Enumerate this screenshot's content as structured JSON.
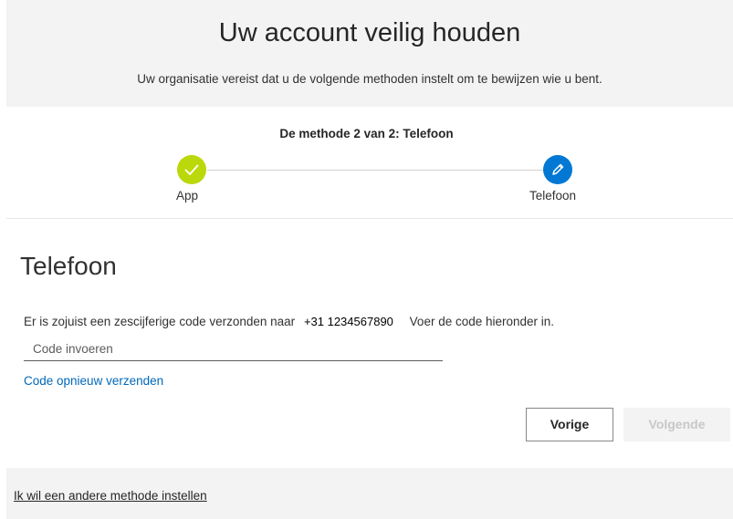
{
  "header": {
    "title": "Uw account veilig houden",
    "subtitle": "Uw organisatie vereist dat u de volgende methoden instelt om te bewijzen wie u bent."
  },
  "stepper": {
    "title": "De methode 2 van 2: Telefoon",
    "steps": [
      {
        "label": "App",
        "status": "completed",
        "icon": "checkmark-icon",
        "color": "#bad80a"
      },
      {
        "label": "Telefoon",
        "status": "current",
        "icon": "pencil-icon",
        "color": "#0078d4"
      }
    ]
  },
  "main": {
    "section_title": "Telefoon",
    "info_prefix": "Er is zojuist een zescijferige code verzonden naar",
    "phone_number": "+31 1234567890",
    "info_suffix": "Voer de code hieronder in.",
    "code_input": {
      "placeholder": "Code invoeren",
      "value": ""
    },
    "resend_link": "Code opnieuw verzenden",
    "back_button": "Vorige",
    "next_button": "Volgende"
  },
  "footer": {
    "other_method_link": "Ik wil een andere methode instellen"
  },
  "colors": {
    "accent": "#0078d4",
    "success": "#bad80a",
    "link": "#0067b8"
  }
}
